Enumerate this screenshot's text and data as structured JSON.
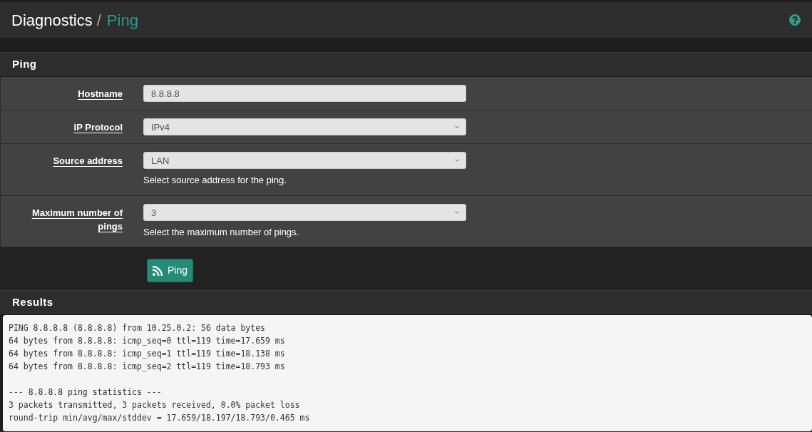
{
  "breadcrumb": {
    "parent": "Diagnostics",
    "separator": "/",
    "current": "Ping"
  },
  "form_panel": {
    "title": "Ping",
    "fields": [
      {
        "kind": "text",
        "label": "Hostname",
        "value": "8.8.8.8"
      },
      {
        "kind": "select",
        "label": "IP Protocol",
        "value": "IPv4"
      },
      {
        "kind": "select",
        "label": "Source address",
        "value": "LAN",
        "help": "Select source address for the ping."
      },
      {
        "kind": "select",
        "label": "Maximum number of pings",
        "value": "3",
        "help": "Select the maximum number of pings."
      }
    ]
  },
  "ping_button": {
    "label": "Ping"
  },
  "results_panel": {
    "title": "Results",
    "output": "PING 8.8.8.8 (8.8.8.8) from 10.25.0.2: 56 data bytes\n64 bytes from 8.8.8.8: icmp_seq=0 ttl=119 time=17.659 ms\n64 bytes from 8.8.8.8: icmp_seq=1 ttl=119 time=18.138 ms\n64 bytes from 8.8.8.8: icmp_seq=2 ttl=119 time=18.793 ms\n\n--- 8.8.8.8 ping statistics ---\n3 packets transmitted, 3 packets received, 0.0% packet loss\nround-trip min/avg/max/stddev = 17.659/18.197/18.793/0.465 ms"
  }
}
